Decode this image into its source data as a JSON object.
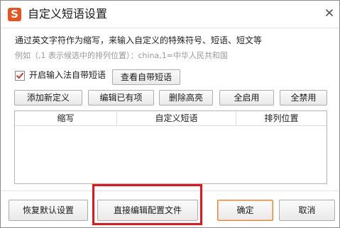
{
  "window": {
    "title": "自定义短语设置",
    "logo_text": "S",
    "logo_icon": "sogou-logo-icon",
    "close_icon": "close-icon",
    "accent_color": "#e8541f"
  },
  "content": {
    "description": "通过英文字符作为缩写，来输入自定义的特殊符号、短语、短文等",
    "example": "例如（,1 表示候选中的排列位置）：china,1=中华人民共和国"
  },
  "options": {
    "enable_builtin_label": "开启输入法自带短语",
    "enable_builtin_checked": true,
    "view_builtin_button": "查看自带短语"
  },
  "toolbar": {
    "add_new": "添加新定义",
    "edit_existing": "编辑已有项",
    "delete_highlighted": "删除高亮",
    "enable_all": "全启用",
    "disable_all": "全禁用"
  },
  "table": {
    "columns": [
      "缩写",
      "自定义短语",
      "排列位置"
    ],
    "rows": []
  },
  "footer": {
    "restore_defaults": "恢复默认设置",
    "edit_config_file": "直接编辑配置文件",
    "ok": "确定",
    "cancel": "取消"
  },
  "annotation": {
    "highlight_color": "#e8141b"
  }
}
